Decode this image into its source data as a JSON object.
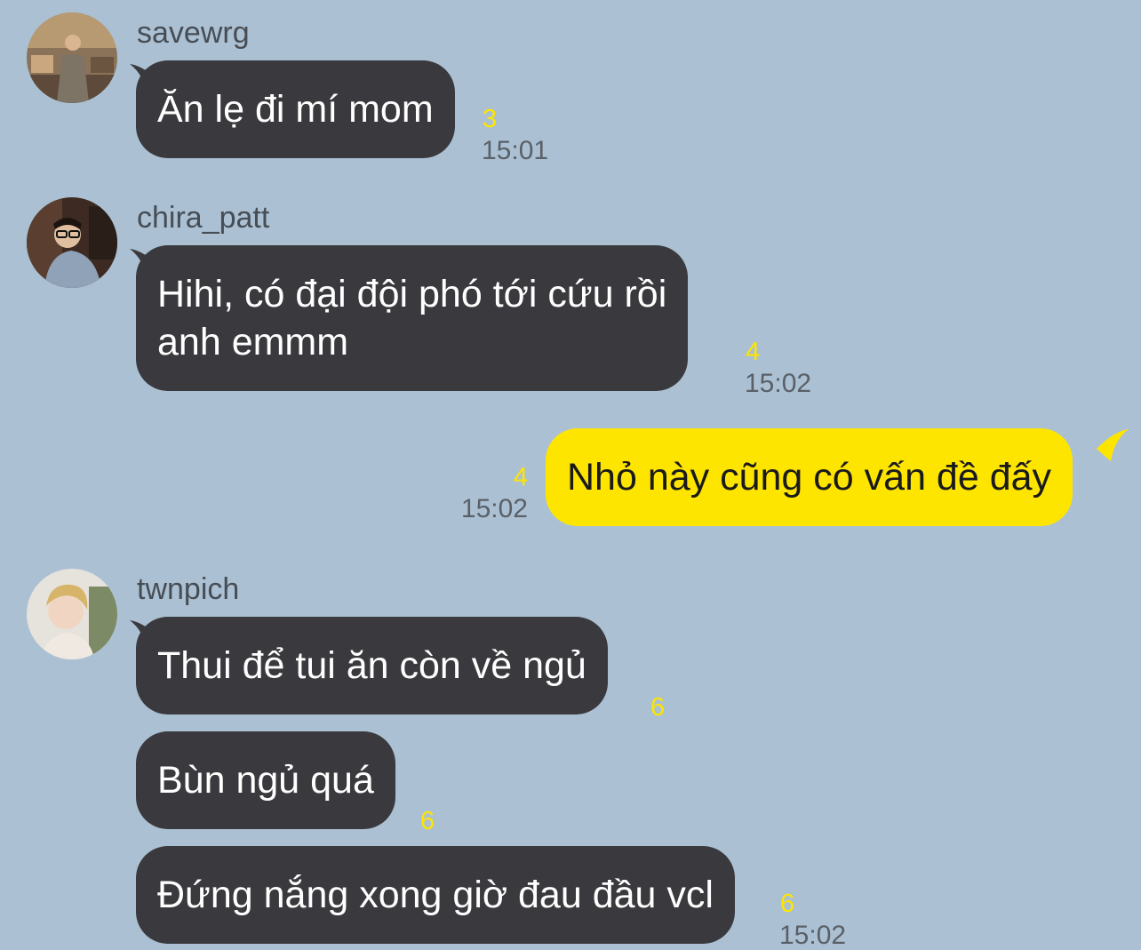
{
  "colors": {
    "background": "#abc1d3",
    "incoming_bubble": "#3a3a3e",
    "outgoing_bubble": "#fee500",
    "unread_count": "#fee500"
  },
  "messages": [
    {
      "sender": "savewrg",
      "text": "Ăn lẹ đi mí mom",
      "unread": "3",
      "time": "15:01"
    },
    {
      "sender": "chira_patt",
      "text_lines": [
        "Hihi, có đại đội phó tới cứu rồi",
        "anh emmm"
      ],
      "unread": "4",
      "time": "15:02"
    },
    {
      "sender": "",
      "text": "Nhỏ này cũng có vấn đề đấy",
      "unread": "4",
      "time": "15:02"
    },
    {
      "sender": "twnpich",
      "text": "Thui để tui ăn còn về ngủ",
      "unread": "6"
    },
    {
      "text": "Bùn ngủ quá",
      "unread": "6"
    },
    {
      "text": "Đứng nắng xong giờ đau đầu vcl",
      "unread": "6",
      "time": "15:02"
    }
  ]
}
